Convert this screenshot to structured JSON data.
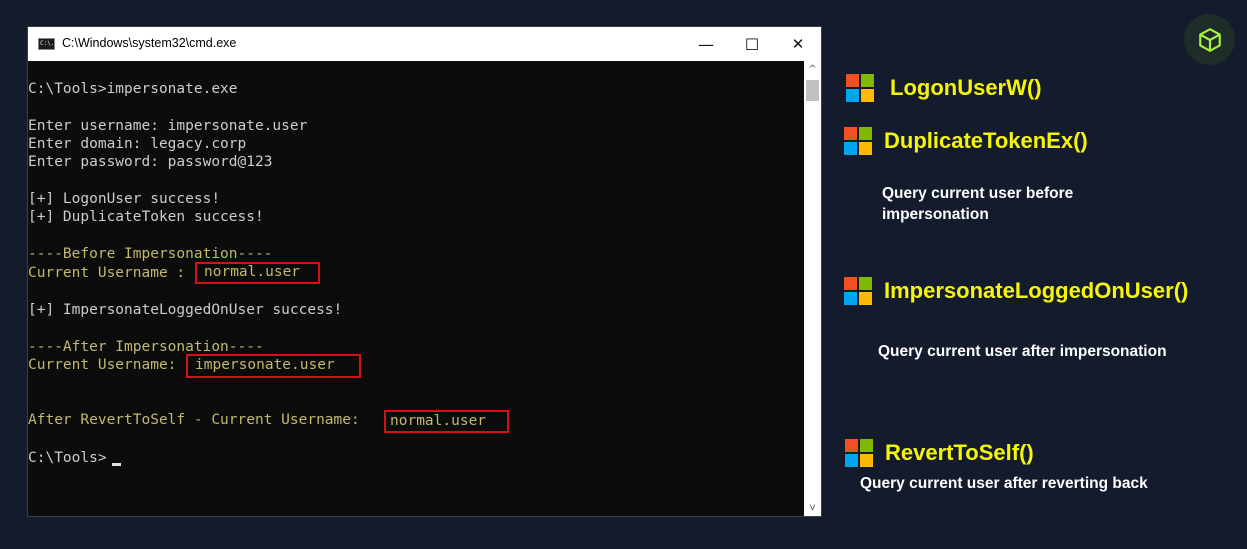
{
  "window": {
    "title": "C:\\Windows\\system32\\cmd.exe",
    "icon_glyph": "C:\\.",
    "buttons": {
      "minimize": "—",
      "maximize": "☐",
      "close": "✕"
    }
  },
  "console": {
    "lines": [
      "C:\\Tools>impersonate.exe",
      "Enter username: impersonate.user",
      "Enter domain: legacy.corp",
      "Enter password: password@123",
      "[+] LogonUser success!",
      "[+] DuplicateToken success!",
      "----Before Impersonation----",
      "Current Username : ",
      "[+] ImpersonateLoggedOnUser success!",
      "----After Impersonation----",
      "Current Username:",
      "After RevertToSelf - Current Username:",
      "C:\\Tools>"
    ],
    "highlights": [
      "normal.user",
      "impersonate.user",
      "normal.user"
    ]
  },
  "scrollbar": {
    "up": "^",
    "down": "v"
  },
  "panel": {
    "items": [
      {
        "api": "LogonUserW()",
        "desc": ""
      },
      {
        "api": "DuplicateTokenEx()",
        "desc": "Query current user before impersonation"
      },
      {
        "api": "ImpersonateLoggedOnUser()",
        "desc": "Query current user after impersonation"
      },
      {
        "api": "RevertToSelf()",
        "desc": "Query current user after reverting back"
      }
    ],
    "desc_lines": {
      "before_1": "Query current user before",
      "before_2": "impersonation"
    }
  },
  "colors": {
    "background": "#131b2c",
    "console_bg": "#0c0c0c",
    "console_text": "#cccccc",
    "console_yellow": "#c3b86d",
    "highlight_border": "#d01414",
    "api_yellow": "#f5f50a",
    "logo_red": "#f25022",
    "logo_green": "#7fba00",
    "logo_blue": "#00a4ef",
    "logo_yellow": "#ffb900",
    "badge_green": "#a4f23a"
  },
  "icons": {
    "window": "cmd-icon",
    "api": "windows-logo-icon",
    "badge": "cube-icon"
  }
}
